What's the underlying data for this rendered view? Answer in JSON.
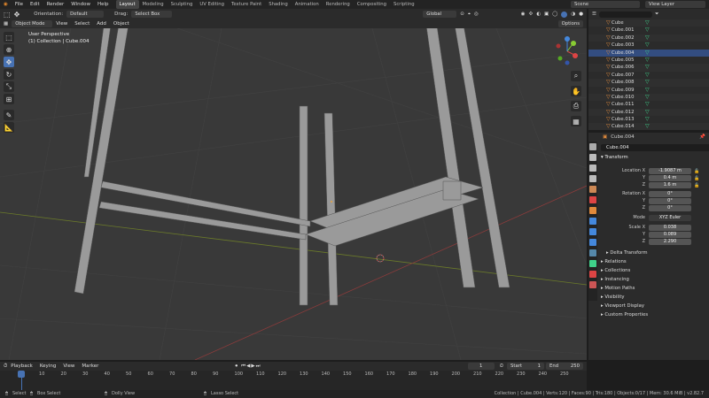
{
  "topbar": {
    "menus": [
      "File",
      "Edit",
      "Render",
      "Window",
      "Help"
    ],
    "workspaces": [
      "Layout",
      "Modeling",
      "Sculpting",
      "UV Editing",
      "Texture Paint",
      "Shading",
      "Animation",
      "Rendering",
      "Compositing",
      "Scripting"
    ],
    "active_workspace": "Layout",
    "scene": "Scene",
    "view_layer": "View Layer"
  },
  "viewport_header": {
    "orientation_label": "Orientation:",
    "orientation_value": "Default",
    "drag_label": "Drag:",
    "drag_value": "Select Box",
    "transform_orientation": "Global",
    "options": "Options"
  },
  "viewport_header2": {
    "mode": "Object Mode",
    "menus": [
      "View",
      "Select",
      "Add",
      "Object"
    ]
  },
  "viewport": {
    "view_name": "User Perspective",
    "collection_info": "(1) Collection | Cube.004"
  },
  "outliner": {
    "items": [
      "Cube",
      "Cube.001",
      "Cube.002",
      "Cube.003",
      "Cube.004",
      "Cube.005",
      "Cube.006",
      "Cube.007",
      "Cube.008",
      "Cube.009",
      "Cube.010",
      "Cube.011",
      "Cube.012",
      "Cube.013",
      "Cube.014"
    ],
    "selected": "Cube.004"
  },
  "properties": {
    "breadcrumb": "Cube.004",
    "object_name": "Cube.004",
    "section_transform": "Transform",
    "location_label": "Location X",
    "location": [
      "-1.9087 m",
      "0.4 m",
      "1.6 m"
    ],
    "rotation_label": "Rotation X",
    "rotation": [
      "0°",
      "0°",
      "0°"
    ],
    "mode_label": "Mode",
    "mode_value": "XYZ Euler",
    "scale_label": "Scale X",
    "scale": [
      "0.038",
      "0.089",
      "2.290"
    ],
    "axis_y": "Y",
    "axis_z": "Z",
    "collapsed_panels": [
      "Delta Transform",
      "Relations",
      "Collections",
      "Instancing",
      "Motion Paths",
      "Visibility",
      "Viewport Display",
      "Custom Properties"
    ]
  },
  "timeline": {
    "menus": [
      "Playback",
      "Keying",
      "View",
      "Marker"
    ],
    "current_frame": "1",
    "start_label": "Start",
    "start": "1",
    "end_label": "End",
    "end": "250",
    "ruler": [
      "1",
      "10",
      "20",
      "30",
      "40",
      "50",
      "60",
      "70",
      "80",
      "90",
      "100",
      "110",
      "120",
      "130",
      "140",
      "150",
      "160",
      "170",
      "180",
      "190",
      "200",
      "210",
      "220",
      "230",
      "240",
      "250"
    ]
  },
  "statusbar": {
    "select": "Select",
    "box_select": "Box Select",
    "dolly_view": "Dolly View",
    "lasso_select": "Lasso Select",
    "stats": "Collection | Cube.004 | Verts:120 | Faces:90 | Tris:180 | Objects:0/17 | Mem: 30.6 MiB | v2.82.7"
  },
  "colors": {
    "accent": "#4772b3",
    "mesh_icon": "#3fd18a",
    "object_icon": "#e08a3c",
    "x_axis": "#8a3b3b",
    "y_axis": "#6b7a2a"
  }
}
